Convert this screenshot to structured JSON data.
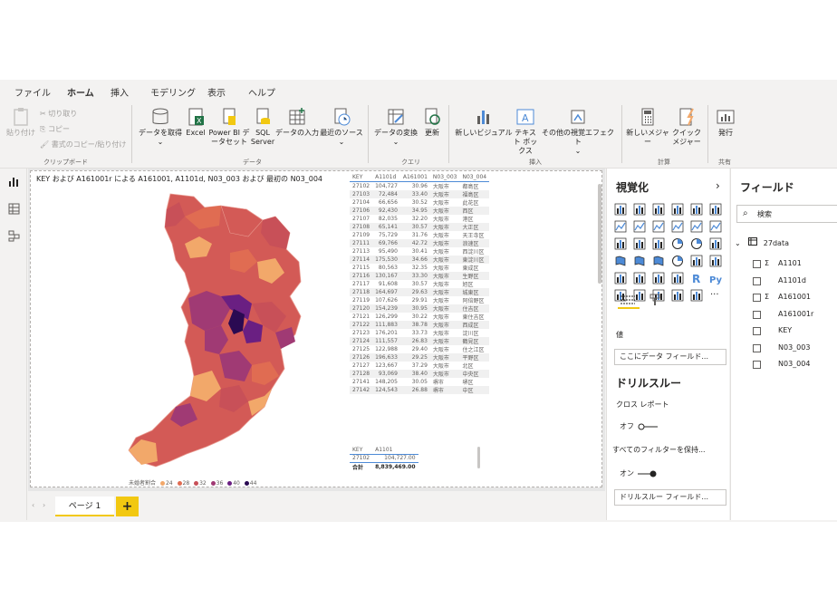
{
  "ribbon": {
    "tabs": [
      "ファイル",
      "ホーム",
      "挿入",
      "モデリング",
      "表示",
      "ヘルプ"
    ],
    "active_tab": "ホーム",
    "clipboard": {
      "paste": "貼り付け",
      "cut": "切り取り",
      "copy": "コピー",
      "format_painter": "書式のコピー/貼り付け",
      "group": "クリップボード"
    },
    "data": {
      "get_data": "データを取得",
      "excel": "Excel",
      "pbi_datasets": "Power BI データセット",
      "sql": "SQL Server",
      "enter_data": "データの入力",
      "recent": "最近のソース",
      "group": "データ"
    },
    "query": {
      "transform": "データの変換",
      "refresh": "更新",
      "group": "クエリ"
    },
    "insert": {
      "new_visual": "新しいビジュアル",
      "textbox": "テキスト ボックス",
      "more_visuals": "その他の視覚エフェクト",
      "group": "挿入"
    },
    "calc": {
      "new_measure": "新しいメジャー",
      "quick_measure": "クイック メジャー",
      "group": "計算"
    },
    "share": {
      "publish": "発行",
      "group": "共有"
    }
  },
  "visual": {
    "title": "KEY および A161001r による A161001, A1101d, N03_003 および 最初の N03_004",
    "legend_title": "未婚者割合",
    "legend_items": [
      {
        "label": "24",
        "color": "#f2a86a"
      },
      {
        "label": "28",
        "color": "#e06c52"
      },
      {
        "label": "32",
        "color": "#c85058"
      },
      {
        "label": "36",
        "color": "#a03a74"
      },
      {
        "label": "40",
        "color": "#6a1f82"
      },
      {
        "label": "44",
        "color": "#2a0a52"
      }
    ]
  },
  "table_main": {
    "headers": [
      "KEY",
      "A1101d",
      "A161001",
      "N03_003",
      "N03_004"
    ],
    "rows": [
      [
        "27102",
        "104,727",
        "30.96",
        "大阪市",
        "都島区"
      ],
      [
        "27103",
        "72,484",
        "33.40",
        "大阪市",
        "福島区"
      ],
      [
        "27104",
        "66,656",
        "30.52",
        "大阪市",
        "此花区"
      ],
      [
        "27106",
        "92,430",
        "34.95",
        "大阪市",
        "西区"
      ],
      [
        "27107",
        "82,035",
        "32.20",
        "大阪市",
        "港区"
      ],
      [
        "27108",
        "65,141",
        "30.57",
        "大阪市",
        "大正区"
      ],
      [
        "27109",
        "75,729",
        "31.76",
        "大阪市",
        "天王寺区"
      ],
      [
        "27111",
        "69,766",
        "42.72",
        "大阪市",
        "浪速区"
      ],
      [
        "27113",
        "95,490",
        "30.41",
        "大阪市",
        "西淀川区"
      ],
      [
        "27114",
        "175,530",
        "34.66",
        "大阪市",
        "東淀川区"
      ],
      [
        "27115",
        "80,563",
        "32.35",
        "大阪市",
        "東成区"
      ],
      [
        "27116",
        "130,167",
        "33.30",
        "大阪市",
        "生野区"
      ],
      [
        "27117",
        "91,608",
        "30.57",
        "大阪市",
        "旭区"
      ],
      [
        "27118",
        "164,697",
        "29.63",
        "大阪市",
        "城東区"
      ],
      [
        "27119",
        "107,626",
        "29.91",
        "大阪市",
        "阿倍野区"
      ],
      [
        "27120",
        "154,239",
        "30.95",
        "大阪市",
        "住吉区"
      ],
      [
        "27121",
        "126,299",
        "30.22",
        "大阪市",
        "東住吉区"
      ],
      [
        "27122",
        "111,883",
        "38.78",
        "大阪市",
        "西成区"
      ],
      [
        "27123",
        "176,201",
        "33.73",
        "大阪市",
        "淀川区"
      ],
      [
        "27124",
        "111,557",
        "26.83",
        "大阪市",
        "鶴見区"
      ],
      [
        "27125",
        "122,988",
        "29.40",
        "大阪市",
        "住之江区"
      ],
      [
        "27126",
        "196,633",
        "29.25",
        "大阪市",
        "平野区"
      ],
      [
        "27127",
        "123,667",
        "37.29",
        "大阪市",
        "北区"
      ],
      [
        "27128",
        "93,069",
        "38.40",
        "大阪市",
        "中央区"
      ],
      [
        "27141",
        "148,205",
        "30.05",
        "堺市",
        "堺区"
      ],
      [
        "27142",
        "124,543",
        "26.88",
        "堺市",
        "中区"
      ]
    ]
  },
  "table_small": {
    "headers": [
      "KEY",
      "A1101"
    ],
    "rows": [
      [
        "27102",
        "104,727.00"
      ]
    ],
    "total_label": "合計",
    "total_value": "8,839,469.00"
  },
  "pages": {
    "tab": "ページ 1",
    "add": "+"
  },
  "viz_pane": {
    "title": "視覚化",
    "values_label": "値",
    "values_placeholder": "ここにデータ フィールド...",
    "drill_title": "ドリルスルー",
    "cross_report": "クロス レポート",
    "cross_state": "オフ",
    "keep_filters": "すべてのフィルターを保持...",
    "keep_state": "オン",
    "drill_placeholder": "ドリルスルー フィールド..."
  },
  "fields_pane": {
    "title": "フィールド",
    "search_placeholder": "検索",
    "table_name": "27data",
    "fields": [
      {
        "name": "A1101",
        "sigma": "Σ"
      },
      {
        "name": "A1101d",
        "sigma": ""
      },
      {
        "name": "A161001",
        "sigma": "Σ"
      },
      {
        "name": "A161001r",
        "sigma": ""
      },
      {
        "name": "KEY",
        "sigma": ""
      },
      {
        "name": "N03_003",
        "sigma": ""
      },
      {
        "name": "N03_004",
        "sigma": ""
      }
    ]
  },
  "colors": {
    "accent_yellow": "#f2c811",
    "excel_green": "#217346",
    "blue": "#4d8ad6"
  }
}
